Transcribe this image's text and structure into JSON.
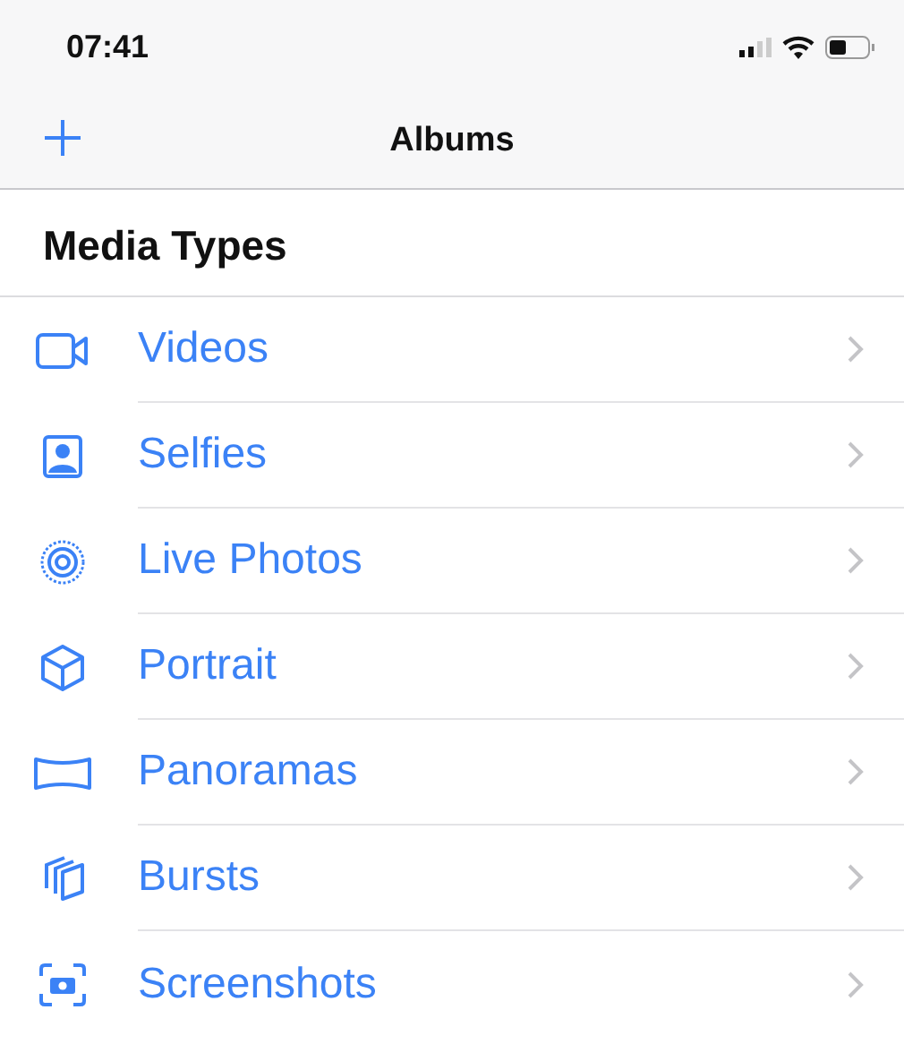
{
  "status_bar": {
    "time": "07:41"
  },
  "nav": {
    "title": "Albums"
  },
  "section": {
    "title": "Media Types"
  },
  "items": [
    {
      "kind": "video",
      "label": "Videos"
    },
    {
      "kind": "selfie",
      "label": "Selfies"
    },
    {
      "kind": "live",
      "label": "Live Photos"
    },
    {
      "kind": "portrait",
      "label": "Portrait"
    },
    {
      "kind": "panorama",
      "label": "Panoramas"
    },
    {
      "kind": "burst",
      "label": "Bursts"
    },
    {
      "kind": "screenshot",
      "label": "Screenshots"
    }
  ]
}
